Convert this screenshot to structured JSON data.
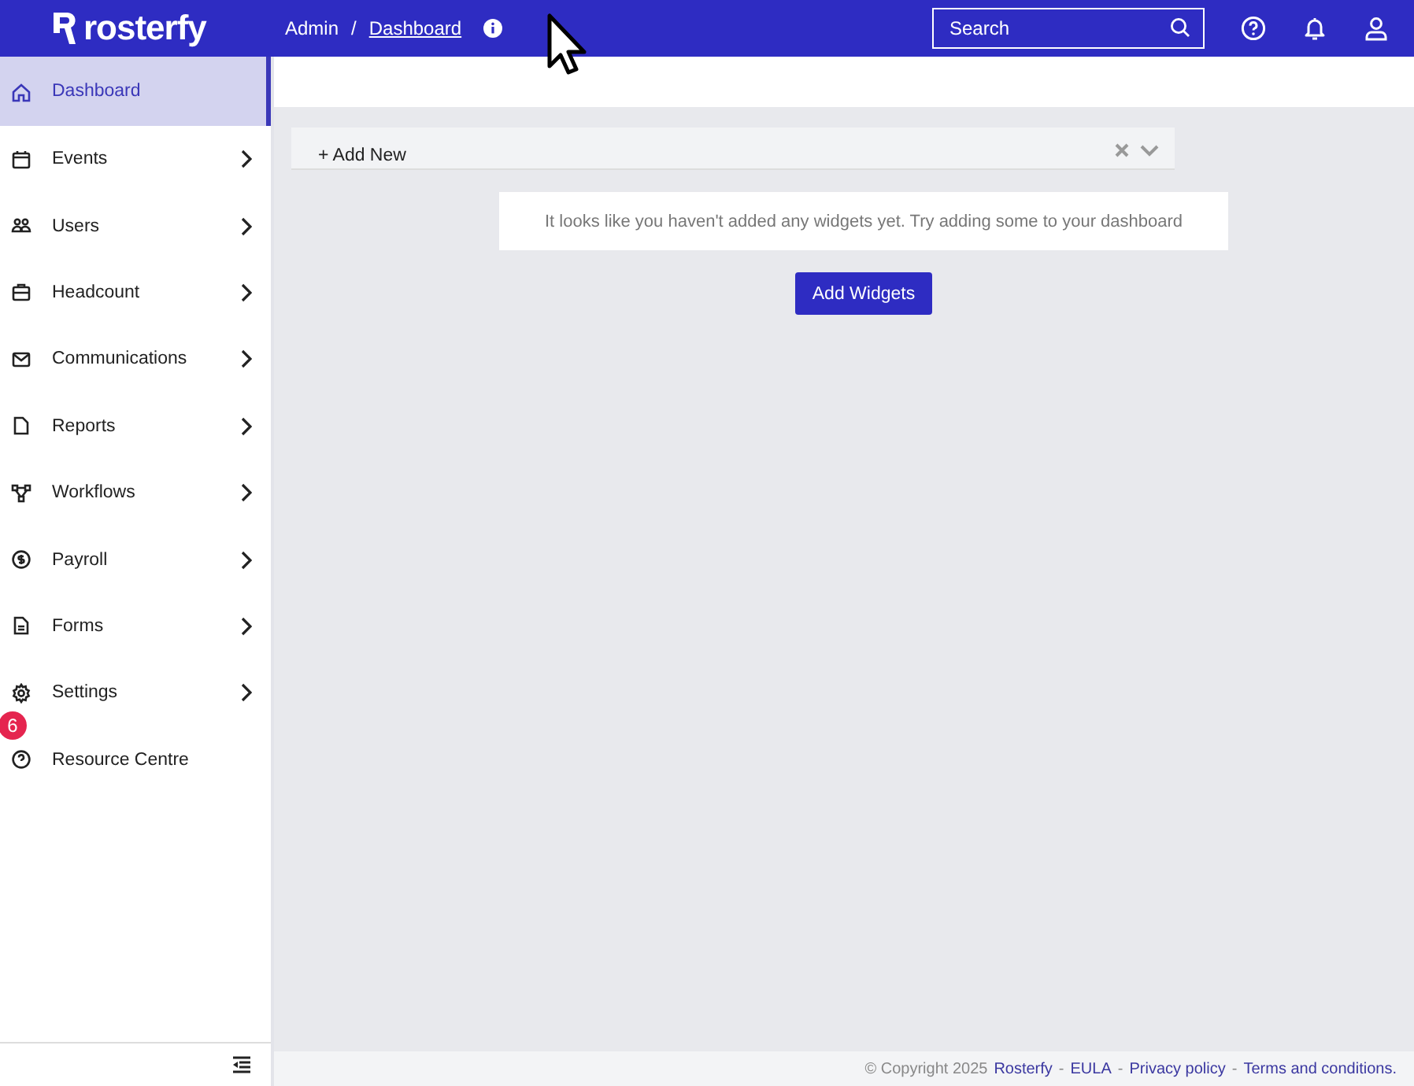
{
  "brand": {
    "name": "rosterfy"
  },
  "breadcrumb": [
    {
      "label": "Admin",
      "link": false
    },
    {
      "label": "Dashboard",
      "link": true
    }
  ],
  "breadcrumb_separator": "/",
  "search": {
    "placeholder": "Search"
  },
  "sidebar": {
    "items": [
      {
        "label": "Dashboard",
        "selected": true,
        "expandable": false
      },
      {
        "label": "Events",
        "selected": false,
        "expandable": true
      },
      {
        "label": "Users",
        "selected": false,
        "expandable": true
      },
      {
        "label": "Headcount",
        "selected": false,
        "expandable": true
      },
      {
        "label": "Communications",
        "selected": false,
        "expandable": true
      },
      {
        "label": "Reports",
        "selected": false,
        "expandable": true
      },
      {
        "label": "Workflows",
        "selected": false,
        "expandable": true
      },
      {
        "label": "Payroll",
        "selected": false,
        "expandable": true
      },
      {
        "label": "Forms",
        "selected": false,
        "expandable": true
      },
      {
        "label": "Settings",
        "selected": false,
        "expandable": true
      },
      {
        "label": "Resource Centre",
        "selected": false,
        "expandable": false
      }
    ],
    "badge": "6"
  },
  "widget_bar": {
    "add_label": "+ Add New"
  },
  "empty_message": "It looks like you haven't added any widgets yet. Try adding some to your dashboard",
  "add_button": "Add Widgets",
  "footer": [
    {
      "text": "© Copyright 2025",
      "kind": "text"
    },
    {
      "text": "Rosterfy",
      "kind": "link"
    },
    {
      "text": "-",
      "kind": "text"
    },
    {
      "text": "EULA",
      "kind": "link"
    },
    {
      "text": "-",
      "kind": "text"
    },
    {
      "text": "Privacy policy",
      "kind": "link"
    },
    {
      "text": "-",
      "kind": "text"
    },
    {
      "text": "Terms and conditions.",
      "kind": "link"
    }
  ]
}
